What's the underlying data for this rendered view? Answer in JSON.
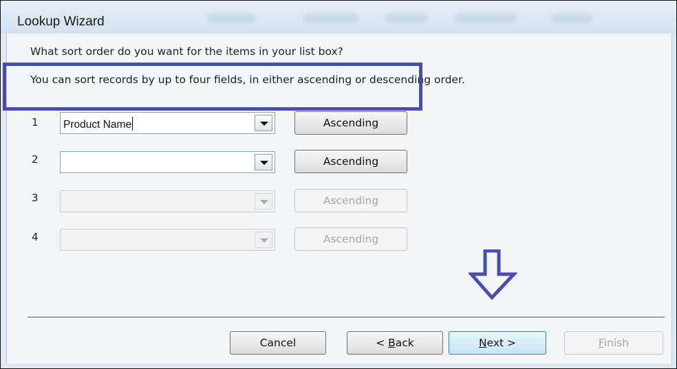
{
  "window": {
    "title": "Lookup Wizard"
  },
  "prompt": {
    "question": "What sort order do you want for the items in your list box?",
    "instructions": "You can sort records by up to four fields, in either ascending or descending order."
  },
  "sort_rows": [
    {
      "number": "1",
      "field_value": "Product Name",
      "order_label": "Ascending",
      "enabled": true
    },
    {
      "number": "2",
      "field_value": "",
      "order_label": "Ascending",
      "enabled": true
    },
    {
      "number": "3",
      "field_value": "",
      "order_label": "Ascending",
      "enabled": false
    },
    {
      "number": "4",
      "field_value": "",
      "order_label": "Ascending",
      "enabled": false
    }
  ],
  "buttons": {
    "cancel": "Cancel",
    "back_prefix": "< ",
    "back_mnemonic": "B",
    "back_rest": "ack",
    "next_mnemonic": "N",
    "next_rest": "ext >",
    "finish_mnemonic": "F",
    "finish_rest": "inish"
  },
  "annotations": {
    "highlight_color": "#4a4db0",
    "arrow_color": "#4a4db0"
  },
  "icons": [
    "dropdown-arrow-icon",
    "down-arrow-annotation-icon"
  ]
}
